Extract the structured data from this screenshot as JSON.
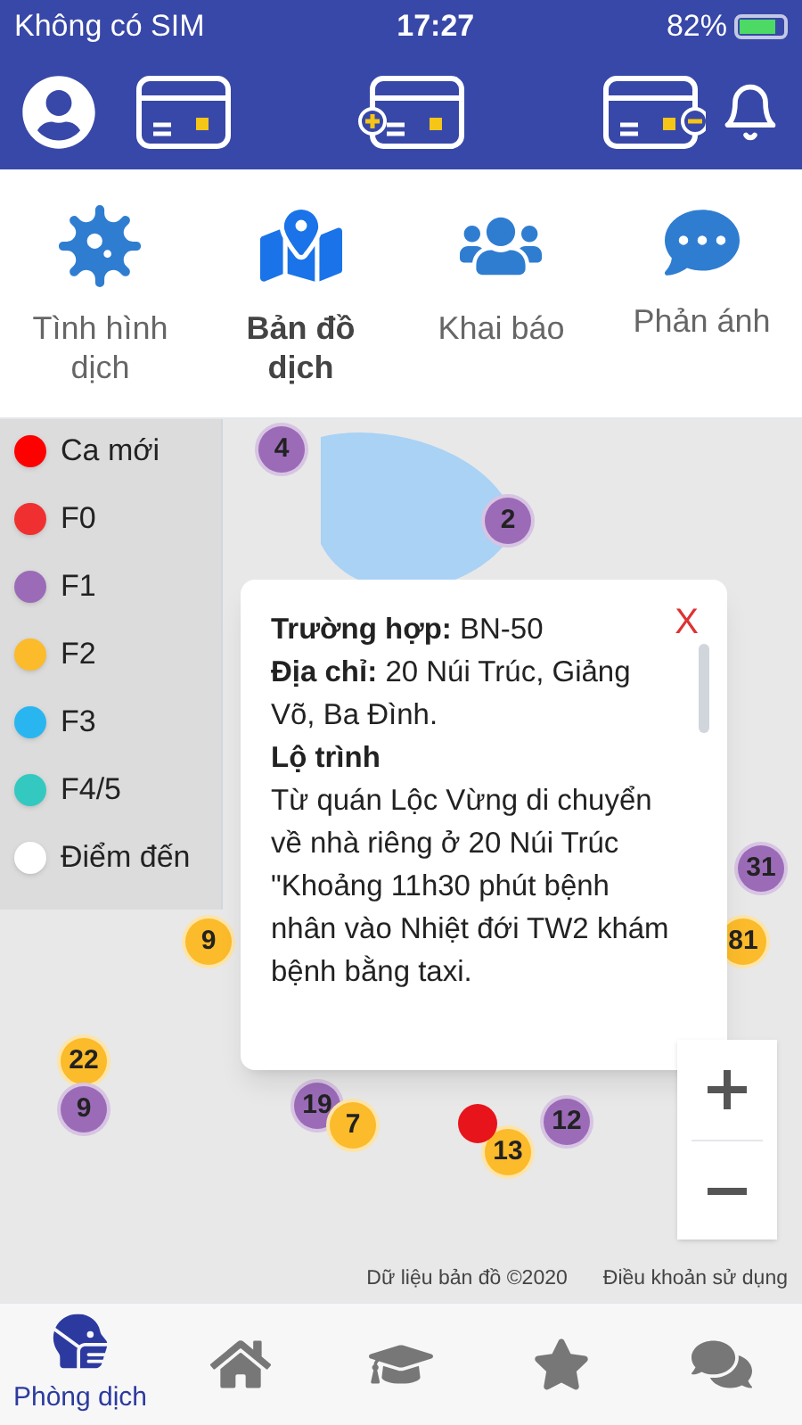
{
  "status_bar": {
    "carrier": "Không có SIM",
    "time": "17:27",
    "battery": "82%"
  },
  "features": [
    {
      "label": "Tình hình dịch",
      "selected": false
    },
    {
      "label": "Bản đồ dịch",
      "selected": true
    },
    {
      "label": "Khai báo",
      "selected": false
    },
    {
      "label": "Phản ánh",
      "selected": false
    }
  ],
  "legend": [
    {
      "label": "Ca mới",
      "color": "#ff0000"
    },
    {
      "label": "F0",
      "color": "#f03030"
    },
    {
      "label": "F1",
      "color": "#9b6bb8"
    },
    {
      "label": "F2",
      "color": "#fbbb2a"
    },
    {
      "label": "F3",
      "color": "#29b6f0"
    },
    {
      "label": "F4/5",
      "color": "#33c9c0"
    },
    {
      "label": "Điểm đến",
      "color": "#ffffff"
    }
  ],
  "markers": [
    {
      "count": "4",
      "color": "#9b6bb8"
    },
    {
      "count": "2",
      "color": "#9b6bb8"
    },
    {
      "count": "31",
      "color": "#9b6bb8"
    },
    {
      "count": "81",
      "color": "#fbbb2a"
    },
    {
      "count": "9",
      "color": "#fbbb2a"
    },
    {
      "count": "22",
      "color": "#fbbb2a"
    },
    {
      "count": "9",
      "color": "#9b6bb8"
    },
    {
      "count": "19",
      "color": "#9b6bb8"
    },
    {
      "count": "7",
      "color": "#fbbb2a"
    },
    {
      "count": "12",
      "color": "#9b6bb8"
    },
    {
      "count": "13",
      "color": "#fbbb2a"
    }
  ],
  "popup": {
    "close": "X",
    "lines": [
      "**Trường hợp:** BN-50",
      "**Địa chỉ:** 20 Núi Trúc, Giảng Võ, Ba Đình.",
      "**Lộ trình**",
      "Từ quán Lộc Vừng di chuyển về nhà riêng ở 20 Núi Trúc",
      "\"Khoảng 11h30 phút bệnh nhân vào Nhiệt đới TW2 khám bệnh bằng taxi."
    ]
  },
  "map_footer": {
    "data": "Dữ liệu bản đồ ©2020",
    "terms": "Điều khoản sử dụng"
  },
  "bottom_nav": [
    {
      "kind": "mask",
      "label": "Phòng dịch",
      "selected": true
    },
    {
      "kind": "home",
      "selected": false
    },
    {
      "kind": "school",
      "selected": false
    },
    {
      "kind": "star",
      "selected": false
    },
    {
      "kind": "chat",
      "selected": false
    }
  ]
}
